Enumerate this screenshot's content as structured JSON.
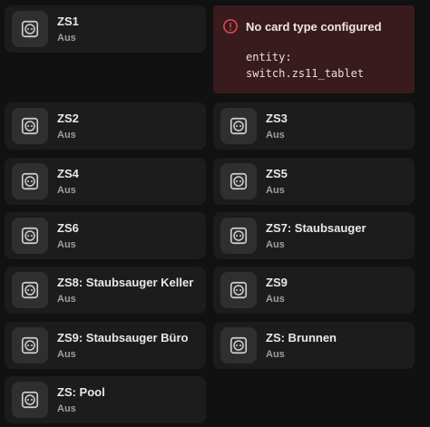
{
  "error_card": {
    "title": "No card type configured",
    "line1": "entity:",
    "line2": "switch.zs11_tablet",
    "accent": "#e5484d"
  },
  "tiles": [
    {
      "name": "ZS1",
      "state": "Aus",
      "icon": "power-socket-icon"
    },
    {
      "name": "ZS2",
      "state": "Aus",
      "icon": "power-socket-icon"
    },
    {
      "name": "ZS3",
      "state": "Aus",
      "icon": "power-socket-icon"
    },
    {
      "name": "ZS4",
      "state": "Aus",
      "icon": "power-socket-icon"
    },
    {
      "name": "ZS5",
      "state": "Aus",
      "icon": "power-socket-icon"
    },
    {
      "name": "ZS6",
      "state": "Aus",
      "icon": "power-socket-icon"
    },
    {
      "name": "ZS7: Staubsauger",
      "state": "Aus",
      "icon": "power-socket-icon"
    },
    {
      "name": "ZS8: Staubsauger Keller",
      "state": "Aus",
      "icon": "power-socket-icon"
    },
    {
      "name": "ZS9",
      "state": "Aus",
      "icon": "power-socket-icon"
    },
    {
      "name": "ZS9: Staubsauger Büro",
      "state": "Aus",
      "icon": "power-socket-icon"
    },
    {
      "name": "ZS: Brunnen",
      "state": "Aus",
      "icon": "power-socket-icon"
    },
    {
      "name": "ZS: Pool",
      "state": "Aus",
      "icon": "power-socket-icon"
    }
  ]
}
